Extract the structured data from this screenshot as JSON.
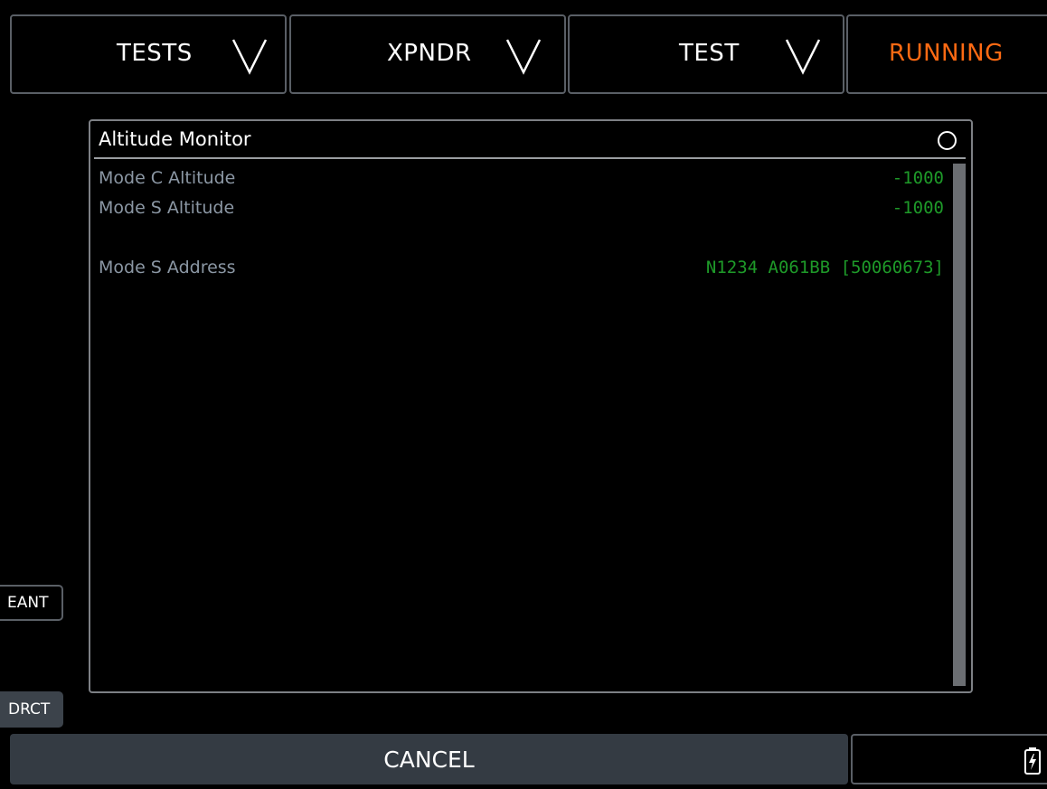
{
  "header": {
    "tabs": [
      {
        "label": "TESTS",
        "icon": "chevron-down-icon"
      },
      {
        "label": "XPNDR",
        "icon": "chevron-down-icon"
      },
      {
        "label": "TEST",
        "icon": "chevron-down-icon"
      }
    ],
    "status": {
      "label": "RUNNING",
      "color": "#ff6a13"
    }
  },
  "panel": {
    "title": "Altitude Monitor",
    "status_icon": "circle-indicator-icon",
    "rows": [
      {
        "label": "Mode C Altitude",
        "value": "-1000"
      },
      {
        "label": "Mode S Altitude",
        "value": "-1000"
      },
      {
        "label": "Mode S Address",
        "value": "N1234 A061BB [50060673]"
      }
    ]
  },
  "side_buttons": {
    "eant": "EANT",
    "drct": "DRCT"
  },
  "footer": {
    "cancel_label": "CANCEL",
    "battery_icon": "battery-charging-icon"
  },
  "colors": {
    "background": "#000000",
    "label_gray": "#8b97a4",
    "value_green": "#1e9a29",
    "status_orange": "#ff6a13",
    "button_fill": "#343b43"
  }
}
